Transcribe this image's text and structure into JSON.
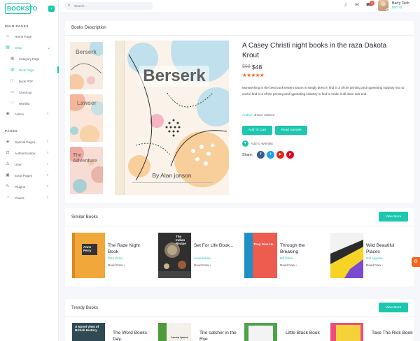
{
  "brand": {
    "logo": "BOOKSTO",
    "accent": "#1bc7ae"
  },
  "header": {
    "search_placeholder": "Search...",
    "cart_count": "8",
    "user_name": "Barry Tech",
    "user_balance": "$20.32"
  },
  "sidebar": {
    "main_heading": "MAIN PAGES",
    "pages_heading": "PAGES",
    "main_items": [
      {
        "label": "Home Page"
      },
      {
        "label": "Shop"
      }
    ],
    "shop_sub": [
      {
        "label": "Category Page"
      },
      {
        "label": "Book Page"
      },
      {
        "label": "Book PDF"
      },
      {
        "label": "Checkout"
      },
      {
        "label": "Wishlist"
      }
    ],
    "admin": {
      "label": "Admin"
    },
    "pages_items": [
      {
        "label": "Special Pages"
      },
      {
        "label": "Authentication"
      },
      {
        "label": "User"
      },
      {
        "label": "Extra Pages"
      },
      {
        "label": "Plugins"
      },
      {
        "label": "Charts"
      }
    ]
  },
  "description_card": {
    "title": "Books Description",
    "thumbs": [
      "Berserk",
      "Lawser",
      "The Adventure"
    ],
    "cover": {
      "title": "Berserk",
      "author": "By Alan jonson"
    },
    "product_title": "A Casey Christi night books in the raza Dakota Krout",
    "price_old": "$99",
    "price_new": "$48",
    "stars": "★★★★★",
    "description": "Monsterhing in the best book testem ipsum is simply dtest in find in a of the printing and typeseting industry into to end.in find in a of the printing and typeseting industry in find to make it all done into end.",
    "author_label": "Author:",
    "author_name": "Jhone Steben",
    "add_to_cart": "Add To Cart",
    "read_sample": "Read Sample",
    "wishlist": "Add to Wishlist",
    "share_label": "Share:"
  },
  "similar_card": {
    "title": "Similar Books",
    "view_more": "View More",
    "books": [
      {
        "title": "The Raze Night Book",
        "author": "Tara Zona",
        "read_more": "Read Now ›",
        "cover_text": "Anne Perry"
      },
      {
        "title": "Set For Life Book...",
        "author": "Anna Rexia",
        "read_more": "Read Now ›",
        "cover_text": "The Indian Recipe"
      },
      {
        "title": "Through the Breaking",
        "author": "Bill Emia",
        "read_more": "Read Now ›",
        "cover_text": "They Give Us"
      },
      {
        "title": "Wild Beautiful Places",
        "author": "Hal Appeno",
        "read_more": "Read Now ›",
        "cover_text": ""
      }
    ]
  },
  "trendy_card": {
    "title": "Trendy Books",
    "view_more": "View More",
    "books": [
      {
        "title": "The Word Books Day..",
        "cover_text": "A Novel View of British History"
      },
      {
        "title": "The catcher in the Rye",
        "cover_text": "Lorem Ipsum"
      },
      {
        "title": "Little Black Book",
        "cover_text": ""
      },
      {
        "title": "Take The Risk Book",
        "cover_text": ""
      }
    ]
  }
}
